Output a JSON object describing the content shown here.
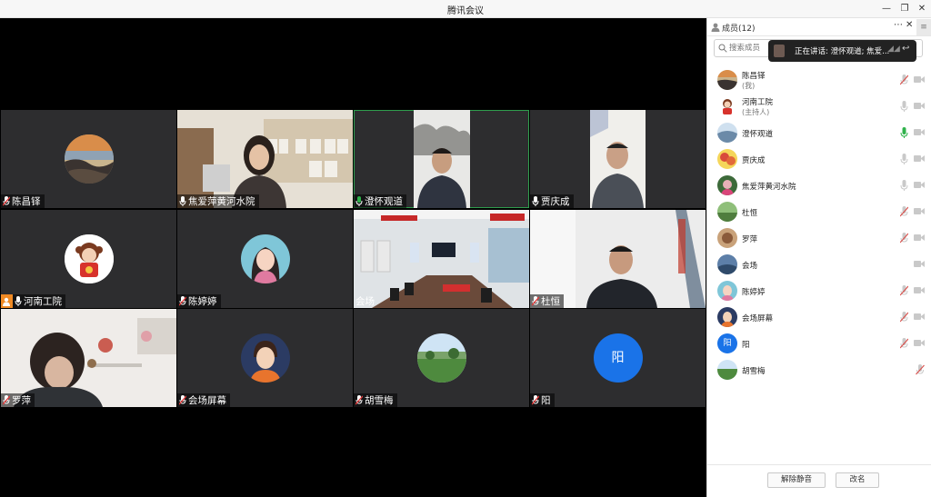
{
  "window": {
    "title": "腾讯会议"
  },
  "tiles": [
    {
      "name": "陈昌铎"
    },
    {
      "name": "焦爱萍黄河水院"
    },
    {
      "name": "澄怀观道"
    },
    {
      "name": "贾庆成"
    },
    {
      "name": "河南工院"
    },
    {
      "name": "陈婷婷"
    },
    {
      "name": "会场"
    },
    {
      "name": "杜恒"
    },
    {
      "name": "罗萍"
    },
    {
      "name": "会场屏幕"
    },
    {
      "name": "胡雪梅"
    },
    {
      "name": "阳",
      "avatar_letter": "阳"
    }
  ],
  "panel": {
    "title": "成员(12)",
    "search_placeholder": "搜索成员",
    "speaking_toast": "正在讲话: 澄怀观道; 焦爱...",
    "members": [
      {
        "name": "陈昌铎",
        "sub": "(我)"
      },
      {
        "name": "河南工院",
        "sub": "(主持人)"
      },
      {
        "name": "澄怀观道"
      },
      {
        "name": "贾庆成"
      },
      {
        "name": "焦爱萍黄河水院"
      },
      {
        "name": "杜恒"
      },
      {
        "name": "罗萍"
      },
      {
        "name": "会场"
      },
      {
        "name": "陈婷婷"
      },
      {
        "name": "会场屏幕"
      },
      {
        "name": "阳",
        "avatar_letter": "阳"
      },
      {
        "name": "胡雪梅"
      }
    ],
    "unmute_all": "解除静音",
    "rename": "改名"
  },
  "colors": {
    "speaking": "#2fb24b",
    "muted": "#d9534f",
    "idle": "#b8b8b8",
    "accent": "#1a73e8",
    "host": "#f08a24"
  }
}
